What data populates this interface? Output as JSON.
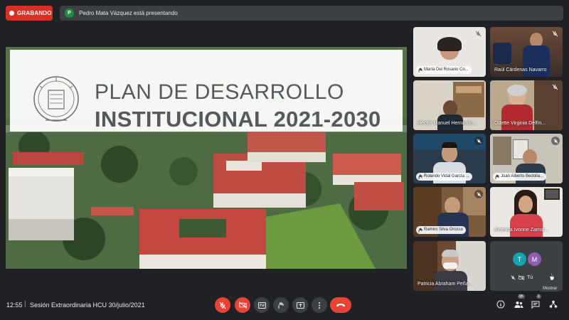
{
  "recording": {
    "label": "GRABANDO",
    "color": "#d93025"
  },
  "presenting": {
    "avatar_letter": "P",
    "text": "Pedro Mata Vázquez está presentando"
  },
  "slide": {
    "title_line1": "PLAN DE DESARROLLO",
    "title_line2_word": "INSTITUCIONAL",
    "title_line2_year": "2021-2030"
  },
  "participants": [
    {
      "name": "María Del Rosario Co...",
      "muted": true,
      "hand_label": true
    },
    {
      "name": "Raúl Cárdenas Navarro",
      "muted": true,
      "hand_label": false
    },
    {
      "name": "Héctor Manuel Hernando...",
      "muted": false,
      "hand_label": false
    },
    {
      "name": "Odette Virginia Delfín...",
      "muted": true,
      "hand_label": false
    },
    {
      "name": "Rolando Vidal García ...",
      "muted": true,
      "hand_label": true
    },
    {
      "name": "Juan Alberto Bedolla...",
      "muted": true,
      "hand_label": true
    },
    {
      "name": "Ramiro Silva Orozco",
      "muted": true,
      "hand_label": true
    },
    {
      "name": "America Ivonne Zamor...",
      "muted": false,
      "hand_label": false
    },
    {
      "name": "Patricia Abraham Peña...",
      "muted": false,
      "hand_label": false
    }
  ],
  "self_tile": {
    "avatars": [
      {
        "letter": "T",
        "color": "#12a4af"
      },
      {
        "letter": "M",
        "color": "#8e5fb0"
      }
    ],
    "you_label": "Tú",
    "tooltip": "Mostrar"
  },
  "bottom_bar": {
    "time": "12:55",
    "separator": "|",
    "meeting_name": "Sesión Extraordinaria HCU 30/julio/2021",
    "participants_count": "95",
    "chat_count": "1"
  }
}
